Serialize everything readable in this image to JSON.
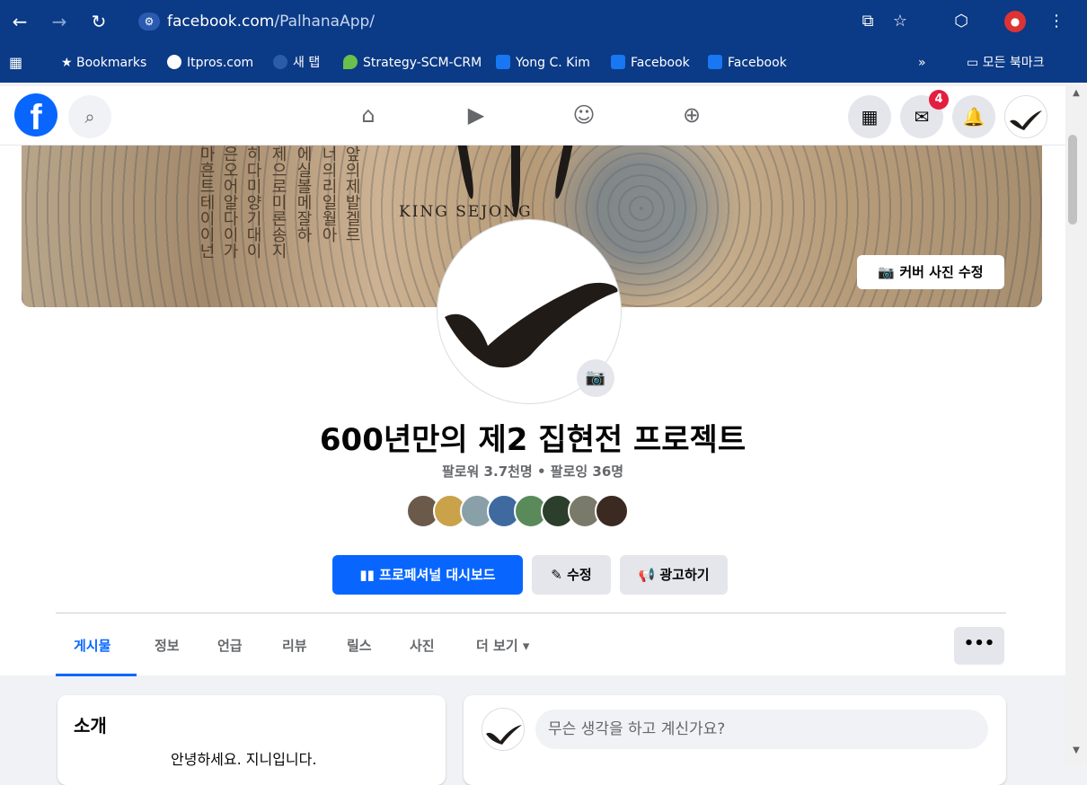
{
  "browser": {
    "url_host": "facebook.com",
    "url_path": "/PalhanaApp/",
    "bookmarks": [
      {
        "label": "Bookmarks"
      },
      {
        "label": "Itpros.com"
      },
      {
        "label": "새 탭"
      },
      {
        "label": "Strategy-SCM-CRM"
      },
      {
        "label": "Yong C. Kim"
      },
      {
        "label": "Facebook"
      },
      {
        "label": "Facebook"
      }
    ],
    "all_bookmarks": "모든 북마크",
    "overflow": "»"
  },
  "fb_nav": {
    "messenger_badge": "4"
  },
  "cover": {
    "art_text": "KING SEJONG",
    "edit_label": "커버 사진 수정"
  },
  "profile": {
    "name": "600년만의 제2 집현전 프로젝트",
    "followers": "팔로워 3.7천명 • 팔로잉 36명"
  },
  "actions": {
    "dashboard": "프로페셔널 대시보드",
    "edit": "수정",
    "advertise": "광고하기"
  },
  "tabs": [
    {
      "label": "게시물"
    },
    {
      "label": "정보"
    },
    {
      "label": "언급"
    },
    {
      "label": "리뷰"
    },
    {
      "label": "릴스"
    },
    {
      "label": "사진"
    },
    {
      "label": "더 보기 ▾"
    }
  ],
  "more_button": "•••",
  "intro": {
    "title": "소개",
    "text": "안녕하세요. 지니입니다."
  },
  "composer": {
    "placeholder": "무슨 생각을 하고 계신가요?"
  },
  "colors": {
    "brand": "#0866ff",
    "chrome": "#0b3a86",
    "badge": "#e41e3f"
  }
}
